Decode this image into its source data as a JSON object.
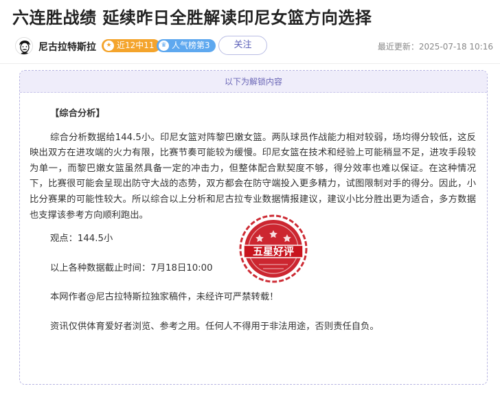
{
  "article": {
    "title": "六连胜战绩 延续昨日全胜解读印尼女篮方向选择",
    "author": "尼古拉特斯拉",
    "badges": {
      "streak": "近12中11",
      "popularity": "人气榜第3"
    },
    "follow_label": "关注",
    "updated": "最近更新：2025-07-18 10:16"
  },
  "locked": {
    "header": "以下为解锁内容",
    "section_title": "【综合分析】",
    "analysis": "综合分析数据给144.5小。印尼女篮对阵黎巴嫩女篮。两队球员作战能力相对较弱，场均得分较低，这反映出双方在进攻端的火力有限，比赛节奏可能较为缓慢。印尼女篮在技术和经验上可能稍显不足，进攻手段较为单一，而黎巴嫩女篮虽然具备一定的冲击力，但整体配合默契度不够，得分效率也难以保证。在这种情况下，比赛很可能会呈现出防守大战的态势，双方都会在防守端投入更多精力，试图限制对手的得分。因此，小比分赛果的可能性较大。所以综合以上分析和尼古拉专业数据情报建议，建议小比分胜出更为适合，多方数据也支撑该参考方向顺利跑出。",
    "viewpoint": "观点：144.5小",
    "cutoff": "以上各种数据截止时间：7月18日10:00",
    "copyright": "本网作者@尼古拉特斯拉独家稿件，未经许可严禁转载！",
    "disclaimer": "资讯仅供体育爱好者浏览、参考之用。任何人不得用于非法用途，否则责任自负。"
  },
  "stamp": {
    "text": "五星好评",
    "color": "#c8141e"
  },
  "colors": {
    "accent": "#6a66b6",
    "badge_orange": "#f4a42c",
    "badge_blue": "#5ea8ef",
    "stamp_red": "#c8141e"
  },
  "icons": {
    "author_avatar": "cartoon-portrait-avatar",
    "streak_badge": "star-icon",
    "popularity_badge": "crown-icon"
  }
}
